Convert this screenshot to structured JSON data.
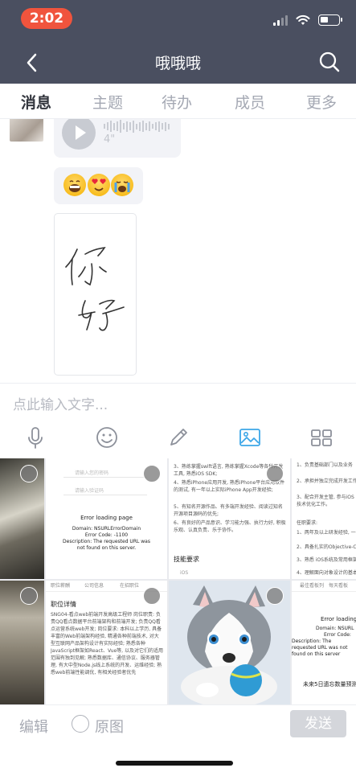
{
  "status_bar": {
    "time": "2:02"
  },
  "header": {
    "title": "哦哦哦"
  },
  "tabs": [
    {
      "label": "消息",
      "active": true
    },
    {
      "label": "主题",
      "active": false
    },
    {
      "label": "待办",
      "active": false
    },
    {
      "label": "成员",
      "active": false
    },
    {
      "label": "更多",
      "active": false
    }
  ],
  "messages": {
    "voice": {
      "duration": "4\""
    }
  },
  "input": {
    "placeholder": "点此输入文字..."
  },
  "gallery": {
    "error_page": {
      "title": "Error loading page",
      "domain": "Domain: NSURLErrorDomain",
      "code": "Error Code: -1100",
      "desc": "Description: The requested URL was not found on this server.",
      "field1": "请输入您的密码",
      "field2": "请输入验证码"
    },
    "job_text": {
      "line1": "3、熟练掌握swift语言, 熟练掌握Xcode等各种开发工具, 熟悉iOS SDK;",
      "line2": "4、熟悉iPhone应用开发, 熟悉iPhone平台应用软件的测试, 有一年以上实际iPhone App开发经验;",
      "line3": "5、有知名开源作品、有多端开发经验、阅读过知名开源项目源码的优先;",
      "line4": "6、有良好的产品意识、学习能力强、执行力好, 积极乐观、认真负责、乐于协作。",
      "section": "技能要求",
      "tag": "iOS"
    },
    "partial_right": {
      "line1": "1、负责基础部门以及业务",
      "line2": "2、承担并独立完成开发工作",
      "line3": "3、配合开发主管, 参与iOS技术优化工作。",
      "req": "任职要求:",
      "r1": "1、两年及以上研发经验, 一年以上",
      "r2": "2、具备扎实的Objective-C基础",
      "r3": "3、熟悉 iOS系统及常用框架, 熟悉",
      "r4": "4、理解面向对象设计的基本原则"
    },
    "job_detail": {
      "tabs": [
        "职位薪酬",
        "公司信息",
        "在招职位"
      ],
      "title": "职位详情",
      "body": "SNG04-看点web前端开发高级工程师 岗位职责: 负责QQ看点数据平台前端架构和前端开发; 负责QQ看点运营系统web开发; 岗位要求: 本科以上学历, 具备丰富的Web前端架构经验, 精通各种前端技术, 对大型互联网产品架构设计有实际经验; 熟悉各种JavaScript框架如React、Vue等, 以及对它们的适用范围有独到见解; 熟悉数据库、通信协议、服务器管理, 有大中型Node.js线上系统的开发、运维经验; 熟悉web前端性能调优, 有相关经验者优先"
    },
    "error_small": {
      "tabs": [
        "最佳看板列",
        "每天看板",
        "关注"
      ],
      "title": "Error loading",
      "domain": "Domain: NSURL",
      "code": "Error Code:",
      "desc": "Description: The requested URL was not found on this server",
      "footer": "未来5日遗忘数量预测"
    }
  },
  "bottom": {
    "edit": "编辑",
    "original": "原图",
    "send": "发送"
  }
}
